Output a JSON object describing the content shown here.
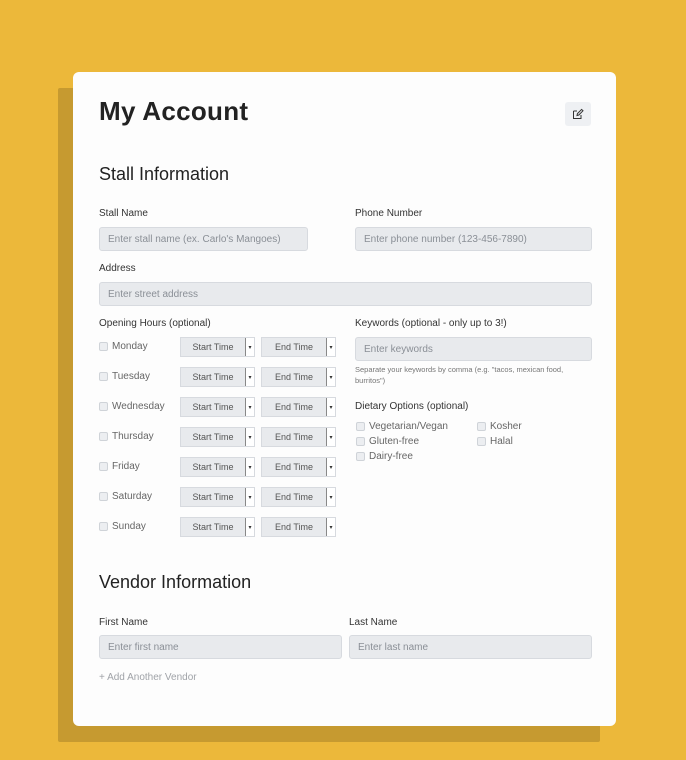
{
  "page": {
    "title": "My Account"
  },
  "stall": {
    "section_title": "Stall Information",
    "stall_name_label": "Stall Name",
    "stall_name_placeholder": "Enter stall name (ex. Carlo's Mangoes)",
    "phone_label": "Phone Number",
    "phone_placeholder": "Enter phone number (123-456-7890)",
    "address_label": "Address",
    "address_placeholder": "Enter street address",
    "hours_label": "Opening Hours (optional)",
    "start_time": "Start Time",
    "end_time": "End Time",
    "days": [
      "Monday",
      "Tuesday",
      "Wednesday",
      "Thursday",
      "Friday",
      "Saturday",
      "Sunday"
    ],
    "keywords_label": "Keywords (optional - only up to 3!)",
    "keywords_placeholder": "Enter keywords",
    "keywords_hint_line1": "Separate your keywords by comma (e.g. \"tacos, mexican food,",
    "keywords_hint_line2": "burritos\")",
    "dietary_label": "Dietary Options (optional)",
    "dietary_options": [
      "Vegetarian/Vegan",
      "Kosher",
      "Gluten-free",
      "Halal",
      "Dairy-free"
    ]
  },
  "vendor": {
    "section_title": "Vendor Information",
    "first_name_label": "First Name",
    "first_name_placeholder": "Enter first name",
    "last_name_label": "Last Name",
    "last_name_placeholder": "Enter last name",
    "add_vendor_label": "+ Add Another Vendor"
  },
  "colors": {
    "background": "#ecb83a",
    "card": "#fdfdfd",
    "input_bg": "#e8eaed"
  },
  "icons": {
    "edit": "pencil-square-icon",
    "dropdown": "caret-down-icon"
  }
}
